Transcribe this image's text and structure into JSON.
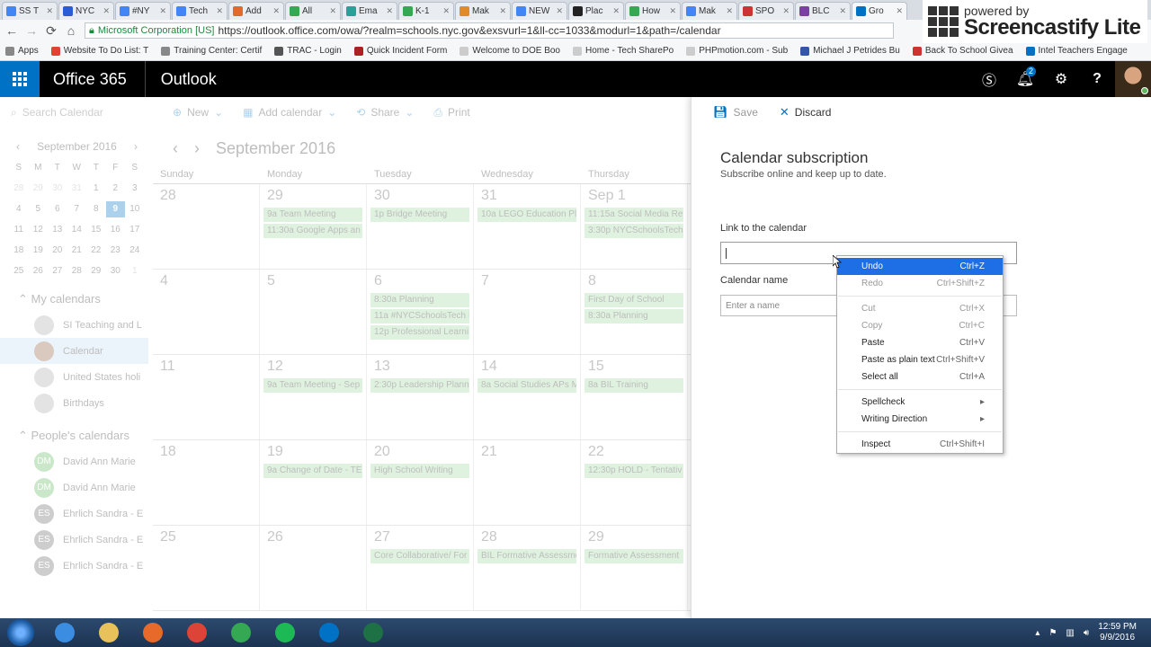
{
  "browser": {
    "tabs": [
      {
        "label": "SS T",
        "fav": "#4285f4"
      },
      {
        "label": "NYC",
        "fav": "#2a5bd7"
      },
      {
        "label": "#NY",
        "fav": "#4285f4"
      },
      {
        "label": "Tech",
        "fav": "#4285f4"
      },
      {
        "label": "Add",
        "fav": "#e06a2a"
      },
      {
        "label": "All",
        "fav": "#34a853"
      },
      {
        "label": "Ema",
        "fav": "#2aa198"
      },
      {
        "label": "K-1",
        "fav": "#34a853"
      },
      {
        "label": "Mak",
        "fav": "#e08a2a"
      },
      {
        "label": "NEW",
        "fav": "#4285f4"
      },
      {
        "label": "Plac",
        "fav": "#222222"
      },
      {
        "label": "How",
        "fav": "#34a853"
      },
      {
        "label": "Mak",
        "fav": "#4285f4"
      },
      {
        "label": "SPO",
        "fav": "#cc3333"
      },
      {
        "label": "BLC",
        "fav": "#7a3fa0"
      },
      {
        "label": "Gro",
        "fav": "#0072c6"
      }
    ],
    "security_label": "Microsoft Corporation [US]",
    "url": "https://outlook.office.com/owa/?realm=schools.nyc.gov&exsvurl=1&ll-cc=1033&modurl=1&path=/calendar",
    "bookmarks": [
      {
        "label": "Apps",
        "fav": "#888888"
      },
      {
        "label": "Website To Do List: T",
        "fav": "#dd4433"
      },
      {
        "label": "Training Center: Certif",
        "fav": "#888888"
      },
      {
        "label": "TRAC - Login",
        "fav": "#555555"
      },
      {
        "label": "Quick Incident Form",
        "fav": "#aa2222"
      },
      {
        "label": "Welcome to DOE Boo",
        "fav": "#cccccc"
      },
      {
        "label": "Home - Tech SharePo",
        "fav": "#cccccc"
      },
      {
        "label": "PHPmotion.com - Sub",
        "fav": "#cccccc"
      },
      {
        "label": "Michael J Petrides Bu",
        "fav": "#3355aa"
      },
      {
        "label": "Back To School Givea",
        "fav": "#cc3333"
      },
      {
        "label": "Intel Teachers Engage",
        "fav": "#0071c5"
      }
    ]
  },
  "watermark": {
    "powered": "powered by",
    "name": "Screencastify Lite"
  },
  "o365": {
    "brand": "Office 365",
    "app": "Outlook",
    "notif_count": "2"
  },
  "toolbar": {
    "search_placeholder": "Search Calendar",
    "new_label": "New",
    "add_calendar_label": "Add calendar",
    "share_label": "Share",
    "print_label": "Print"
  },
  "mini_calendar": {
    "month": "September 2016",
    "weekdays": [
      "S",
      "M",
      "T",
      "W",
      "T",
      "F",
      "S"
    ],
    "days": [
      [
        "28",
        "dim"
      ],
      [
        "29",
        "dim"
      ],
      [
        "30",
        "dim"
      ],
      [
        "31",
        "dim"
      ],
      [
        "1",
        ""
      ],
      [
        "2",
        ""
      ],
      [
        "3",
        ""
      ],
      [
        "4",
        ""
      ],
      [
        "5",
        ""
      ],
      [
        "6",
        ""
      ],
      [
        "7",
        ""
      ],
      [
        "8",
        ""
      ],
      [
        "9",
        "sel"
      ],
      [
        "10",
        ""
      ],
      [
        "11",
        ""
      ],
      [
        "12",
        ""
      ],
      [
        "13",
        ""
      ],
      [
        "14",
        ""
      ],
      [
        "15",
        ""
      ],
      [
        "16",
        ""
      ],
      [
        "17",
        ""
      ],
      [
        "18",
        ""
      ],
      [
        "19",
        ""
      ],
      [
        "20",
        ""
      ],
      [
        "21",
        ""
      ],
      [
        "22",
        ""
      ],
      [
        "23",
        ""
      ],
      [
        "24",
        ""
      ],
      [
        "25",
        ""
      ],
      [
        "26",
        ""
      ],
      [
        "27",
        ""
      ],
      [
        "28",
        ""
      ],
      [
        "29",
        ""
      ],
      [
        "30",
        ""
      ],
      [
        "1",
        "dim"
      ]
    ]
  },
  "my_calendars": {
    "title": "My calendars",
    "items": [
      {
        "label": "SI Teaching and L",
        "icon": "",
        "color": "#aaaaaa",
        "sel": false
      },
      {
        "label": "Calendar",
        "icon": "",
        "color": "#8b5a3c",
        "sel": true
      },
      {
        "label": "United States holi",
        "icon": "",
        "color": "#aaaaaa",
        "sel": false
      },
      {
        "label": "Birthdays",
        "icon": "",
        "color": "#aaaaaa",
        "sel": false
      }
    ]
  },
  "people_calendars": {
    "title": "People's calendars",
    "items": [
      {
        "label": "David Ann Marie",
        "icon": "DM",
        "color": "#5cb85c"
      },
      {
        "label": "David Ann Marie",
        "icon": "DM",
        "color": "#5cb85c"
      },
      {
        "label": "Ehrlich Sandra - E",
        "icon": "ES",
        "color": "#666666"
      },
      {
        "label": "Ehrlich Sandra - E",
        "icon": "ES",
        "color": "#666666"
      },
      {
        "label": "Ehrlich Sandra - E",
        "icon": "ES",
        "color": "#666666"
      }
    ]
  },
  "calendar": {
    "month_title": "September 2016",
    "days": [
      "Sunday",
      "Monday",
      "Tuesday",
      "Wednesday",
      "Thursday"
    ],
    "weeks": [
      [
        {
          "num": "28",
          "events": []
        },
        {
          "num": "29",
          "events": [
            "9a Team Meeting",
            "11:30a Google Apps an"
          ]
        },
        {
          "num": "30",
          "events": [
            "1p Bridge Meeting"
          ]
        },
        {
          "num": "31",
          "events": [
            "10a LEGO Education Pla"
          ]
        },
        {
          "num": "Sep 1",
          "events": [
            "11:15a Social Media Re",
            "3:30p NYCSchoolsTech"
          ]
        }
      ],
      [
        {
          "num": "4",
          "events": []
        },
        {
          "num": "5",
          "events": []
        },
        {
          "num": "6",
          "events": [
            "8:30a Planning",
            "11a #NYCSchoolsTech I",
            "12p Professional Learni"
          ]
        },
        {
          "num": "7",
          "events": []
        },
        {
          "num": "8",
          "events": [
            "First Day of School",
            "8:30a Planning"
          ]
        }
      ],
      [
        {
          "num": "11",
          "events": []
        },
        {
          "num": "12",
          "events": [
            "9a Team Meeting - Sep"
          ]
        },
        {
          "num": "13",
          "events": [
            "2:30p Leadership Plann"
          ]
        },
        {
          "num": "14",
          "events": [
            "8a Social Studies APs M"
          ]
        },
        {
          "num": "15",
          "events": [
            "8a BIL Training"
          ]
        }
      ],
      [
        {
          "num": "18",
          "events": []
        },
        {
          "num": "19",
          "events": [
            "9a Change of Date - TE"
          ]
        },
        {
          "num": "20",
          "events": [
            "High School Writing"
          ]
        },
        {
          "num": "21",
          "events": []
        },
        {
          "num": "22",
          "events": [
            "12:30p HOLD - Tentativ"
          ]
        }
      ],
      [
        {
          "num": "25",
          "events": []
        },
        {
          "num": "26",
          "events": []
        },
        {
          "num": "27",
          "events": [
            "Core Collaborative/ For"
          ]
        },
        {
          "num": "28",
          "events": [
            "BIL Formative Assessme"
          ]
        },
        {
          "num": "29",
          "events": [
            "Formative Assessment"
          ]
        }
      ]
    ]
  },
  "panel": {
    "save_label": "Save",
    "discard_label": "Discard",
    "title": "Calendar subscription",
    "subtitle": "Subscribe online and keep up to date.",
    "link_label": "Link to the calendar",
    "name_label": "Calendar name",
    "name_placeholder": "Enter a name"
  },
  "context_menu": {
    "groups": [
      [
        {
          "label": "Undo",
          "shortcut": "Ctrl+Z",
          "state": "hl"
        },
        {
          "label": "Redo",
          "shortcut": "Ctrl+Shift+Z",
          "state": "dis"
        }
      ],
      [
        {
          "label": "Cut",
          "shortcut": "Ctrl+X",
          "state": "dis"
        },
        {
          "label": "Copy",
          "shortcut": "Ctrl+C",
          "state": "dis"
        },
        {
          "label": "Paste",
          "shortcut": "Ctrl+V",
          "state": ""
        },
        {
          "label": "Paste as plain text",
          "shortcut": "Ctrl+Shift+V",
          "state": ""
        },
        {
          "label": "Select all",
          "shortcut": "Ctrl+A",
          "state": ""
        }
      ],
      [
        {
          "label": "Spellcheck",
          "shortcut": "▸",
          "state": ""
        },
        {
          "label": "Writing Direction",
          "shortcut": "▸",
          "state": ""
        }
      ],
      [
        {
          "label": "Inspect",
          "shortcut": "Ctrl+Shift+I",
          "state": ""
        }
      ]
    ]
  },
  "taskbar": {
    "apps": [
      {
        "name": "internet-explorer",
        "color": "#3a8de0"
      },
      {
        "name": "file-explorer",
        "color": "#e8c15a"
      },
      {
        "name": "media-player",
        "color": "#e86a2a"
      },
      {
        "name": "chrome",
        "color": "#db4437"
      },
      {
        "name": "chrome-profile",
        "color": "#34a853"
      },
      {
        "name": "spotify",
        "color": "#1db954"
      },
      {
        "name": "outlook",
        "color": "#0072c6"
      },
      {
        "name": "excel",
        "color": "#1e7145"
      }
    ],
    "time": "12:59 PM",
    "date": "9/9/2016"
  }
}
